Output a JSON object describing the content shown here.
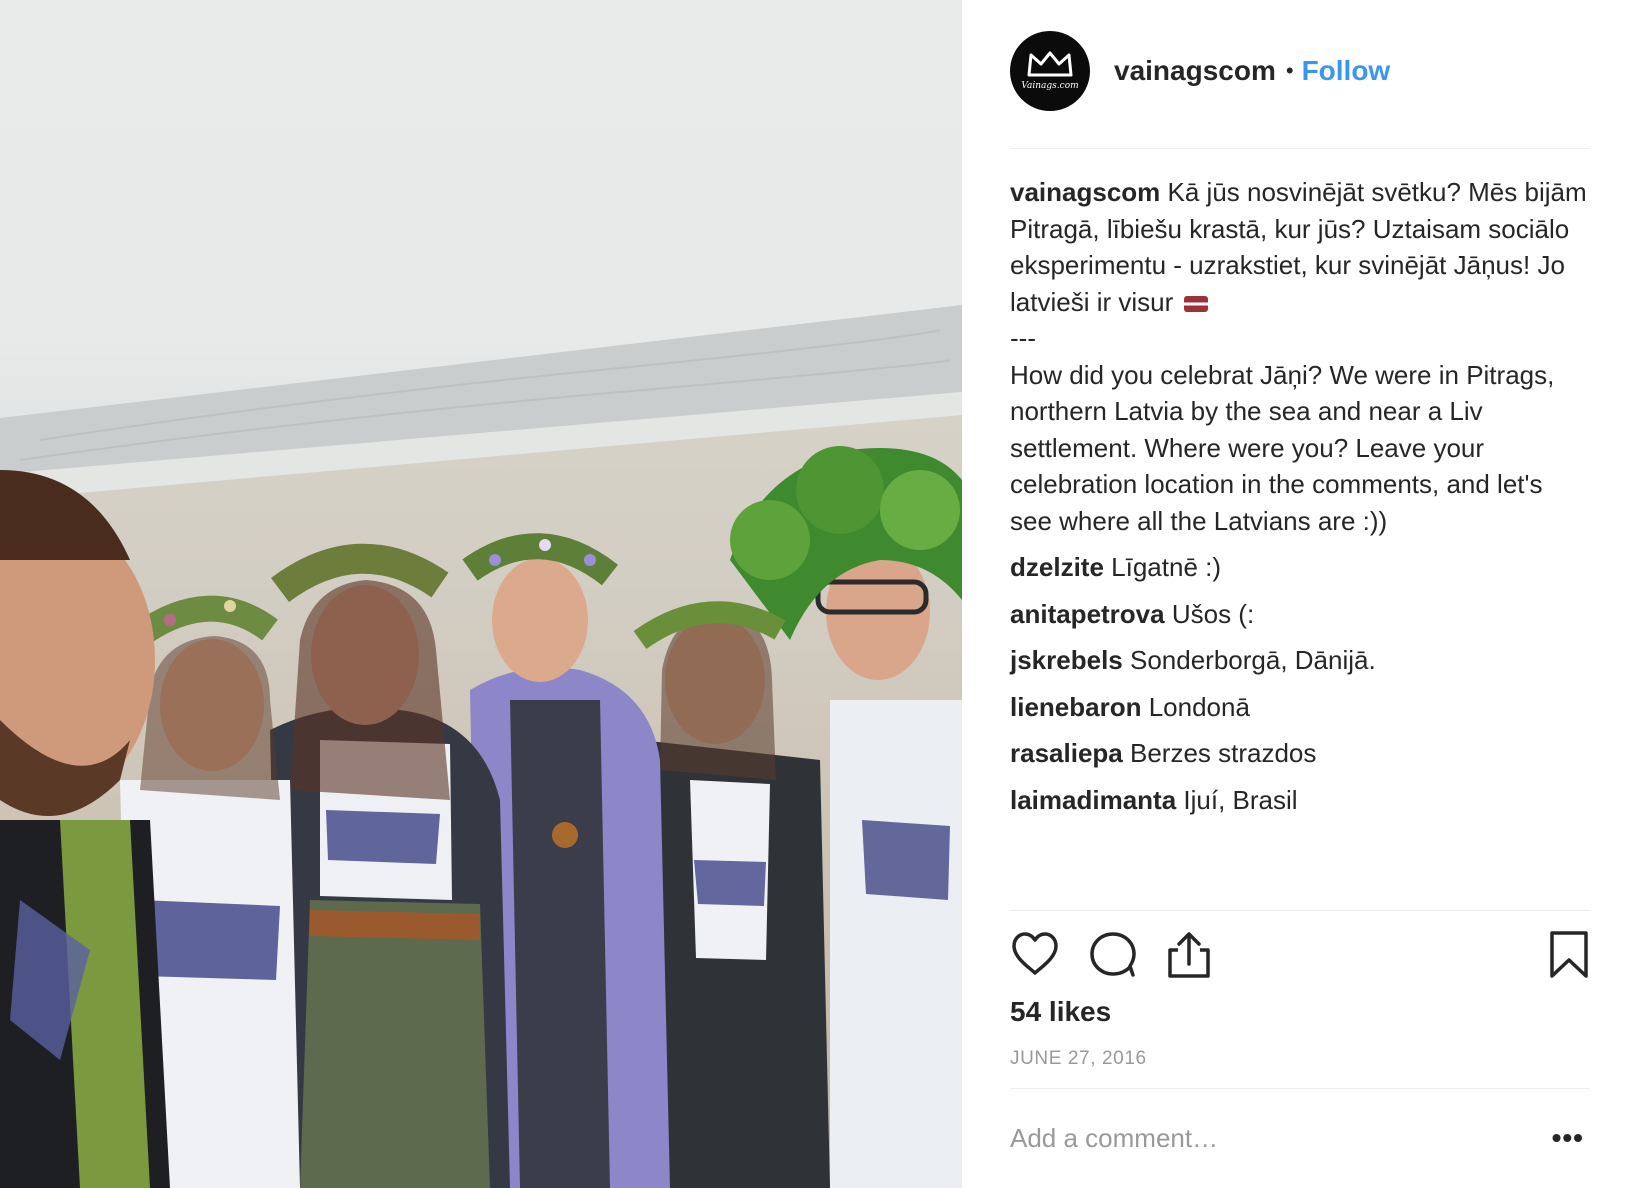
{
  "post": {
    "photo_alt": "Group selfie of six people wearing flower and leaf crowns on a beach",
    "header": {
      "avatar_label": "Vainags.com",
      "username": "vainagscom",
      "separator": "•",
      "follow_label": "Follow"
    },
    "caption": {
      "username": "vainagscom",
      "text": "Kā jūs nosvinējāt svētku? Mēs bijām Pitragā, lībiešu krastā, kur jūs? Uztaisam sociālo eksperimentu - uzrakstiet, kur svinējāt Jāņus! Jo latvieši ir visur ",
      "text_after_flag": "\n---\nHow did you celebrat Jāņi? We were in Pitrags, northern Latvia by the sea and near a Liv settlement. Where were you? Leave your celebration location in the comments, and let's see where all the Latvians are :))"
    },
    "comments": [
      {
        "username": "dzelzite",
        "text": "Līgatnē :)"
      },
      {
        "username": "anitapetrova",
        "text": "Ušos (:"
      },
      {
        "username": "jskrebels",
        "text": "Sonderborgā, Dānijā."
      },
      {
        "username": "lienebaron",
        "text": "Londonā"
      },
      {
        "username": "rasaliepa",
        "text": "Berzes strazdos"
      },
      {
        "username": "laimadimanta",
        "text": "Ijuí, Brasil"
      }
    ],
    "actions": {
      "like_icon": "heart-icon",
      "comment_icon": "speech-bubble-icon",
      "share_icon": "share-icon",
      "save_icon": "bookmark-icon"
    },
    "likes": "54 likes",
    "date": "JUNE 27, 2016",
    "add_comment_placeholder": "Add a comment…",
    "more_label": "•••"
  }
}
